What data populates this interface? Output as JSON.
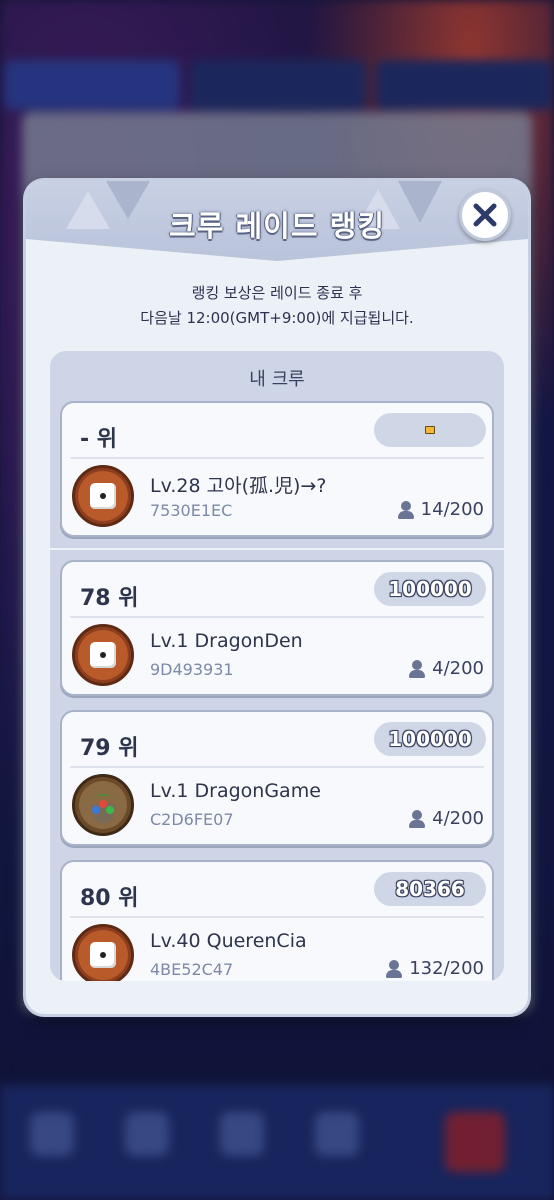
{
  "modal": {
    "title": "크루 레이드 랭킹",
    "notice_line1": "랭킹 보상은 레이드 종료 후",
    "notice_line2": "다음날 12:00(GMT+9:00)에 지급됩니다.",
    "close_icon": "close-icon"
  },
  "my_crew": {
    "section_title": "내 크루",
    "rank": "- 위",
    "score": "",
    "name": "Lv.28 고아(孤.児)→?",
    "code": "7530E1EC",
    "members": "14/200",
    "avatar_icon": "dice-icon"
  },
  "ranking": [
    {
      "rank": "78 위",
      "score": "100000",
      "name": "Lv.1 DragonDen",
      "code": "9D493931",
      "members": "4/200",
      "avatar_icon": "dice-icon"
    },
    {
      "rank": "79 위",
      "score": "100000",
      "name": "Lv.1 DragonGame",
      "code": "C2D6FE07",
      "members": "4/200",
      "avatar_icon": "dragon-emblem-icon"
    },
    {
      "rank": "80 위",
      "score": "80366",
      "name": "Lv.40 QuerenCia",
      "code": "4BE52C47",
      "members": "132/200",
      "avatar_icon": "dice-icon"
    }
  ],
  "colors": {
    "modal_bg": "#ecf0f7",
    "panel_bg": "#cdd5e6",
    "card_bg": "#f8f9fc",
    "text_dark": "#2e344c",
    "text_code": "#7d89a8",
    "avatar_brown": "#8c3e1e"
  }
}
